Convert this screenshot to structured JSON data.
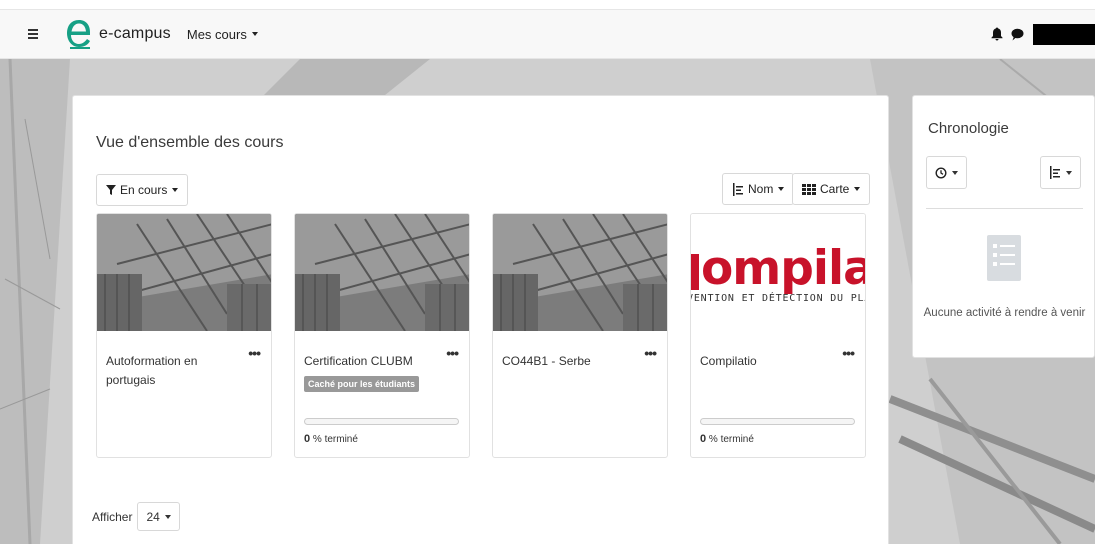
{
  "navbar": {
    "brand_name": "e-campus",
    "menu_label": "Mes cours",
    "icons": [
      "menu-icon",
      "bell-icon",
      "chat-icon"
    ],
    "colors": {
      "brand_teal": "#16a085",
      "navbar_bg": "#f8f8f8"
    }
  },
  "overview": {
    "title": "Vue d'ensemble des cours",
    "filter_label": "En cours",
    "sort_label": "Nom",
    "view_label": "Carte",
    "courses": [
      {
        "name": "Autoformation en portugais",
        "image": "photo",
        "hidden_badge": "",
        "progress_text": ""
      },
      {
        "name": "Certification CLUBM",
        "image": "photo",
        "hidden_badge": "Caché pour les étudiants",
        "progress_value": "0",
        "progress_text": "% terminé",
        "progress_fraction": 0
      },
      {
        "name": "CO44B1 - Serbe",
        "image": "photo",
        "hidden_badge": "",
        "progress_text": ""
      },
      {
        "name": "Compilatio",
        "image": "compilatio-logo",
        "logo_word": "ompilatic",
        "logo_tagline": "VENTION ET DÉTECTION DU PLAGI.",
        "hidden_badge": "",
        "progress_value": "0",
        "progress_text": "% terminé",
        "progress_fraction": 0
      }
    ],
    "show_label": "Afficher",
    "show_count": "24",
    "colors": {
      "compilatio_red": "#c8122a",
      "badge_gray": "#999999"
    }
  },
  "chronologie": {
    "title": "Chronologie",
    "empty_text": "Aucune activité à rendre à venir",
    "icons": [
      "clock-icon",
      "sort-list-icon",
      "empty-list-icon"
    ]
  }
}
